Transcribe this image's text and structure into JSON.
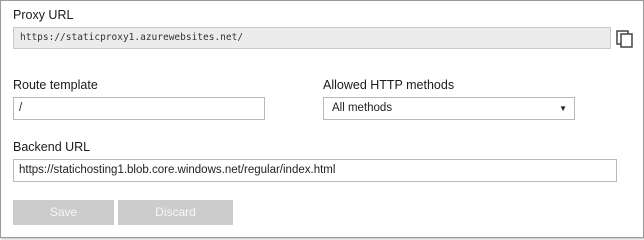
{
  "proxy": {
    "label": "Proxy URL",
    "value": "https://staticproxy1.azurewebsites.net/"
  },
  "route": {
    "label": "Route template",
    "value": "/"
  },
  "methods": {
    "label": "Allowed HTTP methods",
    "selected": "All methods"
  },
  "backend": {
    "label": "Backend URL",
    "value": "https://statichosting1.blob.core.windows.net/regular/index.html"
  },
  "actions": {
    "save_label": "Save",
    "discard_label": "Discard"
  },
  "icons": {
    "copy": "copy-icon",
    "dropdown": "chevron-down-icon"
  },
  "colors": {
    "button_disabled": "#cccccc",
    "readonly_field": "#ececec"
  }
}
